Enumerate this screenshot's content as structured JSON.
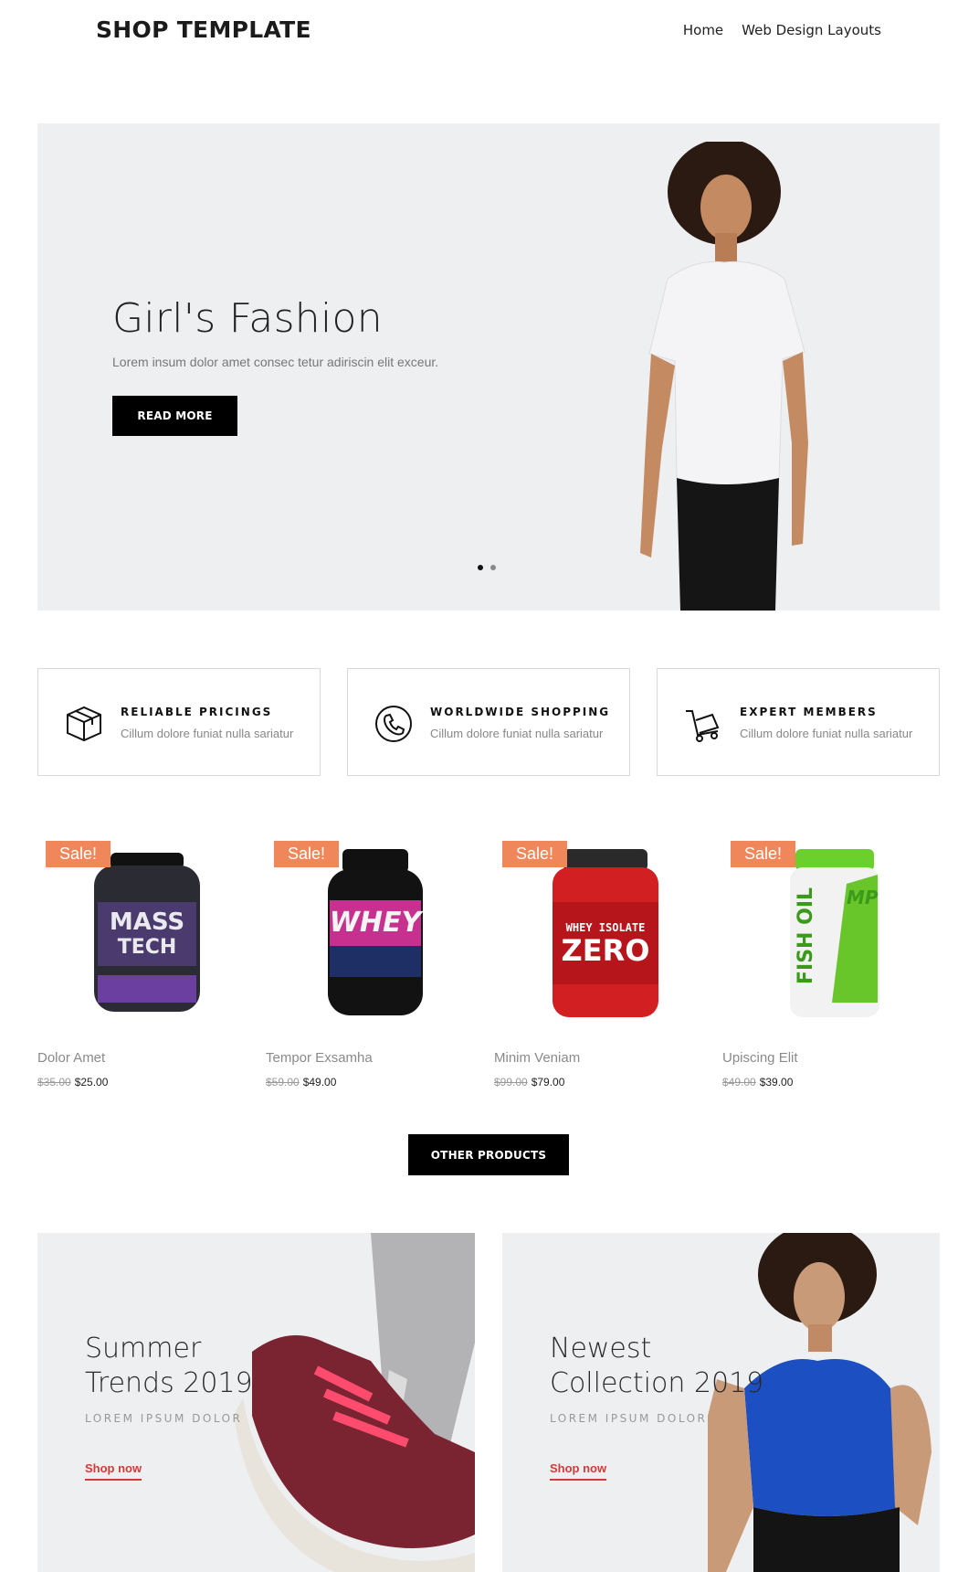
{
  "header": {
    "brand": "SHOP TEMPLATE",
    "nav": [
      "Home",
      "Web Design Layouts"
    ]
  },
  "hero": {
    "title": "Girl's Fashion",
    "subtitle": "Lorem insum dolor amet consec tetur adiriscin elit exceur.",
    "button": "READ MORE",
    "slides": 2,
    "active_slide": 1
  },
  "features": [
    {
      "icon": "box-icon",
      "title": "RELIABLE PRICINGS",
      "subtitle": "Cillum dolore funiat nulla sariatur"
    },
    {
      "icon": "phone-icon",
      "title": "WORLDWIDE SHOPPING",
      "subtitle": "Cillum dolore funiat nulla sariatur"
    },
    {
      "icon": "cart-icon",
      "title": "EXPERT MEMBERS",
      "subtitle": "Cillum dolore funiat nulla sariatur"
    }
  ],
  "products": [
    {
      "badge": "Sale!",
      "name": "Dolor Amet",
      "old_price": "$35.00",
      "price": "$25.00",
      "image": "mass-tech-tub"
    },
    {
      "badge": "Sale!",
      "name": "Tempor Exsamha",
      "old_price": "$59.00",
      "price": "$49.00",
      "image": "whey-tub"
    },
    {
      "badge": "Sale!",
      "name": "Minim Veniam",
      "old_price": "$99.00",
      "price": "$79.00",
      "image": "zero-tub"
    },
    {
      "badge": "Sale!",
      "name": "Upiscing Elit",
      "old_price": "$49.00",
      "price": "$39.00",
      "image": "fish-oil-tub"
    }
  ],
  "other_button": "OTHER PRODUCTS",
  "promos": [
    {
      "title": "Summer\nTrends 2019",
      "subtitle": "LOREM IPSUM DOLOR",
      "link": "Shop now"
    },
    {
      "title": "Newest\nCollection 2019",
      "subtitle": "LOREM IPSUM DOLOR",
      "link": "Shop now"
    }
  ],
  "colors": {
    "sale_badge": "#f0875a",
    "link_red": "#d33a3a",
    "hero_bg": "#eeeff1"
  }
}
